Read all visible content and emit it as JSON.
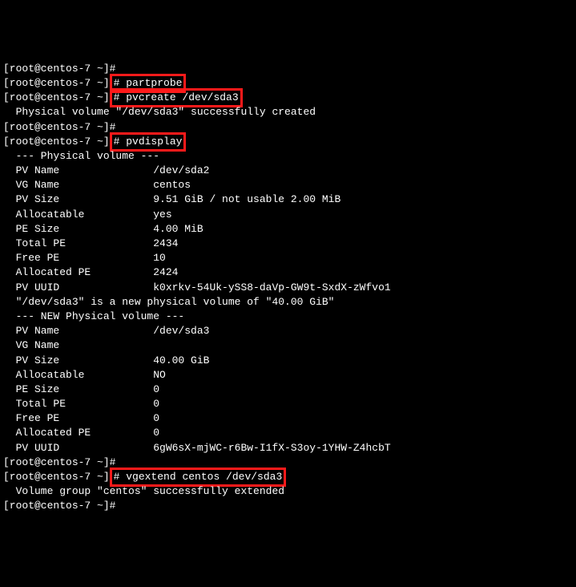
{
  "lines": {
    "l0": "[root@centos-7 ~]#",
    "l1_prompt": "[root@centos-7 ~]",
    "l1_cmd": "# partprobe",
    "l2_prompt": "[root@centos-7 ~]",
    "l2_cmd": "# pvcreate /dev/sda3",
    "l3": "  Physical volume \"/dev/sda3\" successfully created",
    "l4": "[root@centos-7 ~]#",
    "l5_prompt": "[root@centos-7 ~]",
    "l5_cmd": "# pvdisplay",
    "l6": "  --- Physical volume ---",
    "l7": "  PV Name               /dev/sda2",
    "l8": "  VG Name               centos",
    "l9": "  PV Size               9.51 GiB / not usable 2.00 MiB",
    "l10": "  Allocatable           yes",
    "l11": "  PE Size               4.00 MiB",
    "l12": "  Total PE              2434",
    "l13": "  Free PE               10",
    "l14": "  Allocated PE          2424",
    "l15": "  PV UUID               k0xrkv-54Uk-ySS8-daVp-GW9t-SxdX-zWfvo1",
    "l16": "",
    "l17": "  \"/dev/sda3\" is a new physical volume of \"40.00 GiB\"",
    "l18": "  --- NEW Physical volume ---",
    "l19": "  PV Name               /dev/sda3",
    "l20": "  VG Name               ",
    "l21": "  PV Size               40.00 GiB",
    "l22": "  Allocatable           NO",
    "l23": "  PE Size               0",
    "l24": "  Total PE              0",
    "l25": "  Free PE               0",
    "l26": "  Allocated PE          0",
    "l27": "  PV UUID               6gW6sX-mjWC-r6Bw-I1fX-S3oy-1YHW-Z4hcbT",
    "l28": "",
    "l29": "[root@centos-7 ~]#",
    "l30_prompt": "[root@centos-7 ~]",
    "l30_cmd": "# vgextend centos /dev/sda3",
    "l31": "  Volume group \"centos\" successfully extended",
    "l32": "[root@centos-7 ~]#"
  }
}
